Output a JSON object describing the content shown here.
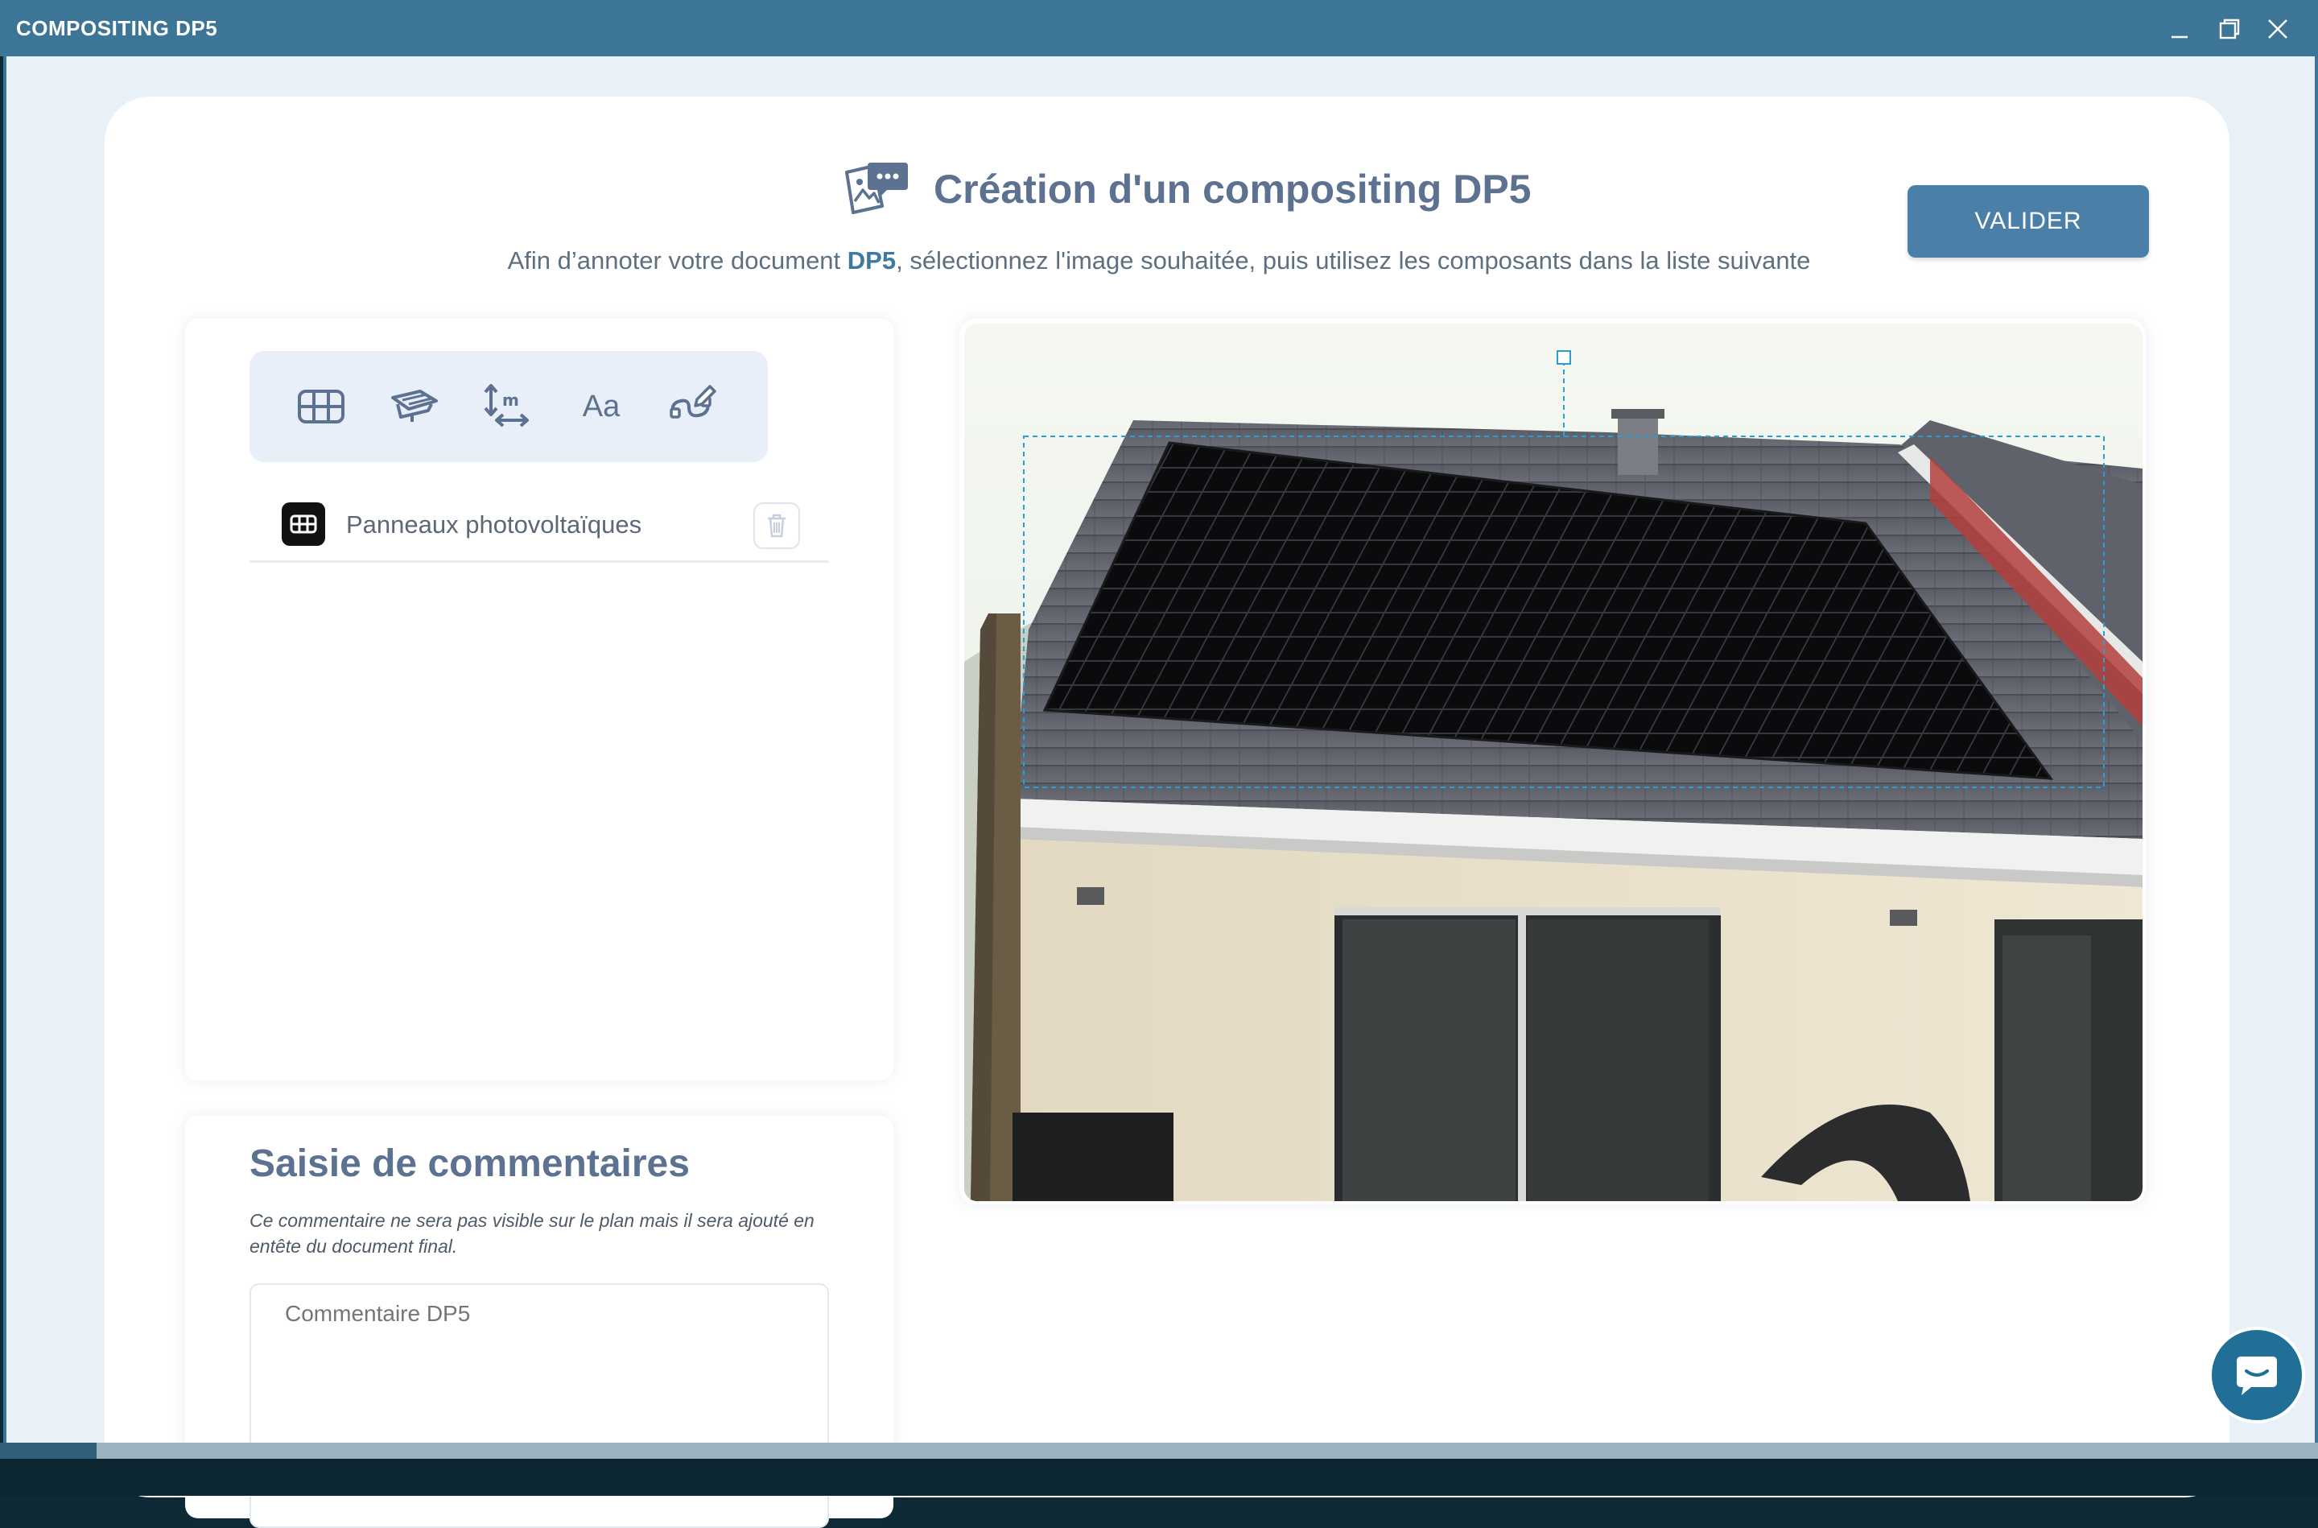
{
  "window": {
    "title": "COMPOSITING DP5",
    "controls": [
      "minimize-icon",
      "restore-icon",
      "close-icon"
    ]
  },
  "header": {
    "icon": "photo-annotation-icon",
    "title": "Création d'un compositing DP5",
    "subtitle_before": "Afin d’annoter votre document ",
    "subtitle_highlight": "DP5",
    "subtitle_after": ", sélectionnez l'image souhaitée, puis utilisez les composants dans la liste suivante",
    "validate_label": "VALIDER"
  },
  "toolbar": {
    "tools": [
      {
        "name": "solar-panel-grid-tool",
        "icon": "grid-icon"
      },
      {
        "name": "roof-panel-tool",
        "icon": "roof-icon"
      },
      {
        "name": "measure-tool",
        "icon": "dimension-arrows-icon"
      },
      {
        "name": "text-tool",
        "icon": "text-icon",
        "label": "Aa"
      },
      {
        "name": "draw-tool",
        "icon": "pen-path-icon"
      }
    ]
  },
  "layers": [
    {
      "label": "Panneaux photovoltaïques",
      "icon": "grid-icon"
    }
  ],
  "comments": {
    "title": "Saisie de commentaires",
    "note": "Ce commentaire ne sera pas visible sur le plan mais il sera ajouté en entête du document final.",
    "placeholder": "Commentaire DP5"
  },
  "colors": {
    "titlebar": "#3c7596",
    "accent": "#4a7fa8",
    "title_text": "#5d7191",
    "selection": "#2a9fd6"
  },
  "chat": {
    "icon": "chat-bubble-icon"
  }
}
